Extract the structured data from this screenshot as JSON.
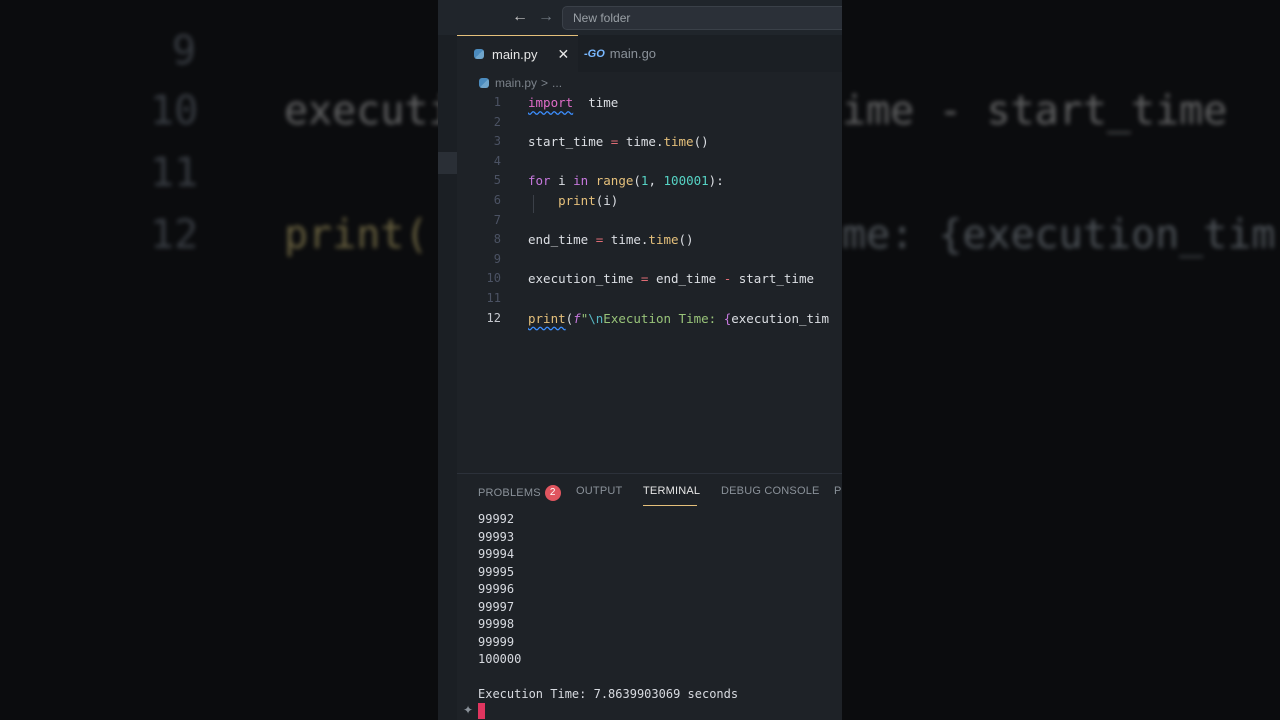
{
  "background": {
    "left_lines": [
      {
        "ln": "9",
        "code": ""
      },
      {
        "ln": "10",
        "code": "executi"
      },
      {
        "ln": "11",
        "code": ""
      },
      {
        "ln": "12",
        "code": "print("
      }
    ],
    "right_lines": [
      {
        "code": "ime - start_time"
      },
      {
        "code": "me: {execution_tim"
      }
    ]
  },
  "titlebar": {
    "back_icon": "arrow-left-icon",
    "forward_icon": "arrow-right-icon",
    "search_text": "New folder"
  },
  "tabs": [
    {
      "label": "main.py",
      "icon": "python-icon",
      "active": true,
      "close": "✕"
    },
    {
      "label": "main.go",
      "icon": "go-icon",
      "active": false,
      "icon_text": "-GO"
    }
  ],
  "breadcrumb": {
    "file": "main.py",
    "sep": ">",
    "rest": "..."
  },
  "code_lines": [
    {
      "n": "1",
      "tokens": [
        [
          "kw-imp",
          "import"
        ],
        [
          "var",
          "  time"
        ]
      ]
    },
    {
      "n": "2",
      "tokens": []
    },
    {
      "n": "3",
      "tokens": [
        [
          "var",
          "start_time "
        ],
        [
          "op",
          "="
        ],
        [
          "var",
          " time."
        ],
        [
          "fn",
          "time"
        ],
        [
          "var",
          "()"
        ]
      ]
    },
    {
      "n": "4",
      "tokens": []
    },
    {
      "n": "5",
      "tokens": [
        [
          "kw",
          "for"
        ],
        [
          "var",
          " i "
        ],
        [
          "kw",
          "in"
        ],
        [
          "var",
          " "
        ],
        [
          "fn",
          "range"
        ],
        [
          "var",
          "("
        ],
        [
          "num",
          "1"
        ],
        [
          "var",
          ", "
        ],
        [
          "num",
          "100001"
        ],
        [
          "var",
          "):"
        ]
      ]
    },
    {
      "n": "6",
      "tokens": [
        [
          "var",
          "    "
        ],
        [
          "fn",
          "print"
        ],
        [
          "var",
          "(i)"
        ]
      ]
    },
    {
      "n": "7",
      "tokens": []
    },
    {
      "n": "8",
      "tokens": [
        [
          "var",
          "end_time "
        ],
        [
          "op",
          "="
        ],
        [
          "var",
          " time."
        ],
        [
          "fn",
          "time"
        ],
        [
          "var",
          "()"
        ]
      ]
    },
    {
      "n": "9",
      "tokens": []
    },
    {
      "n": "10",
      "tokens": [
        [
          "var",
          "execution_time "
        ],
        [
          "op",
          "="
        ],
        [
          "var",
          " end_time "
        ],
        [
          "op",
          "-"
        ],
        [
          "var",
          " start_time"
        ]
      ]
    },
    {
      "n": "11",
      "tokens": []
    },
    {
      "n": "12",
      "tokens": [
        [
          "fnu",
          "print"
        ],
        [
          "var",
          "("
        ],
        [
          "fstr",
          "f"
        ],
        [
          "str",
          "\""
        ],
        [
          "esc",
          "\\n"
        ],
        [
          "str",
          "Execution Time: "
        ],
        [
          "brace",
          "{"
        ],
        [
          "var",
          "execution_tim"
        ]
      ]
    }
  ],
  "panel": {
    "tabs": [
      "PROBLEMS",
      "OUTPUT",
      "TERMINAL",
      "DEBUG CONSOLE",
      "P"
    ],
    "active_tab": "TERMINAL",
    "problems_count": "2",
    "terminal_lines": [
      "99992",
      "99993",
      "99994",
      "99995",
      "99996",
      "99997",
      "99998",
      "99999",
      "100000",
      "",
      "Execution Time: 7.8639903069 seconds"
    ]
  },
  "colors": {
    "accent": "#e5c07b",
    "badge": "#e0555f",
    "editor_bg": "#1e2227"
  }
}
